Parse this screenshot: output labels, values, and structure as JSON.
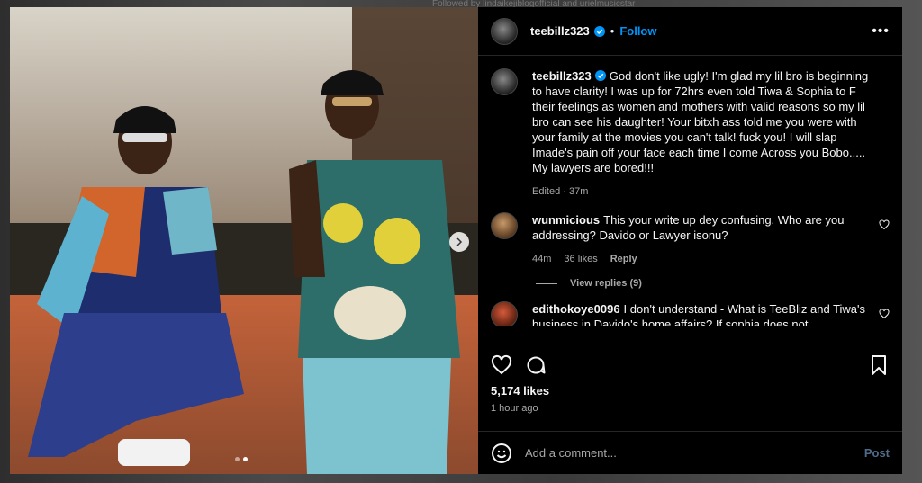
{
  "backdrop": {
    "followed_by": "Followed by lindaikejiblogofficial and urielmusicstar"
  },
  "post": {
    "username": "teebillz323",
    "follow_label": "Follow",
    "separator": "•",
    "more_label": "•••",
    "caption": {
      "username": "teebillz323",
      "text": "God don't like ugly! I'm glad my lil bro is beginning to have clarity! I was up for 72hrs even told Tiwa & Sophia to F their feelings as women and mothers with valid reasons so my lil bro can see his daughter! Your bitxh ass told me you were with your family at the movies you can't talk! fuck you! I will slap Imade's pain off your face each time I come Across you Bobo..... My lawyers are bored!!!",
      "edited": "Edited · 37m"
    },
    "comments": [
      {
        "username": "wunmicious",
        "text": "This your write up dey confusing. Who are you addressing? Davido or Lawyer isonu?",
        "time": "44m",
        "likes": "36 likes",
        "reply_label": "Reply",
        "view_replies": "View replies (9)"
      },
      {
        "username": "edithokoye0096",
        "text": "I don't understand - What is TeeBliz and Tiwa's business in Davido's home affairs? If sophia does not"
      }
    ],
    "likes_count": "5,174 likes",
    "posted_time": "1 hour ago",
    "add_comment_placeholder": "Add a comment...",
    "post_label": "Post",
    "carousel": {
      "slides": 2,
      "active": 1
    }
  },
  "icons": [
    "verified-icon",
    "more-icon",
    "heart-icon",
    "comment-icon",
    "bookmark-icon",
    "emoji-icon",
    "chevron-right-icon"
  ],
  "colors": {
    "accent": "#0095f6",
    "background": "#000000",
    "muted": "#a8a8a8"
  }
}
